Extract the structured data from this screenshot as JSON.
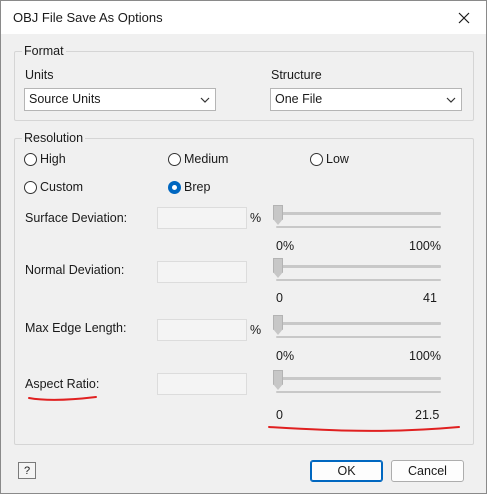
{
  "window": {
    "title": "OBJ File Save As Options"
  },
  "format": {
    "group_title": "Format",
    "units_label": "Units",
    "units_value": "Source Units",
    "structure_label": "Structure",
    "structure_value": "One File"
  },
  "resolution": {
    "group_title": "Resolution",
    "radios": [
      {
        "label": "High",
        "checked": false
      },
      {
        "label": "Medium",
        "checked": false
      },
      {
        "label": "Low",
        "checked": false
      },
      {
        "label": "Custom",
        "checked": false
      },
      {
        "label": "Brep",
        "checked": true
      }
    ],
    "rows": [
      {
        "label": "Surface Deviation:",
        "unit": "%",
        "min": "0%",
        "max": "100%",
        "slider_fraction": 0
      },
      {
        "label": "Normal Deviation:",
        "unit": "",
        "min": "0",
        "max": "41",
        "slider_fraction": 0
      },
      {
        "label": "Max Edge Length:",
        "unit": "%",
        "min": "0%",
        "max": "100%",
        "slider_fraction": 0
      },
      {
        "label": "Aspect Ratio:",
        "unit": "",
        "min": "0",
        "max": "21.5",
        "slider_fraction": 0
      }
    ]
  },
  "buttons": {
    "help": "?",
    "ok": "OK",
    "cancel": "Cancel"
  },
  "colors": {
    "accent": "#0067c0",
    "annotation": "#e02020"
  }
}
